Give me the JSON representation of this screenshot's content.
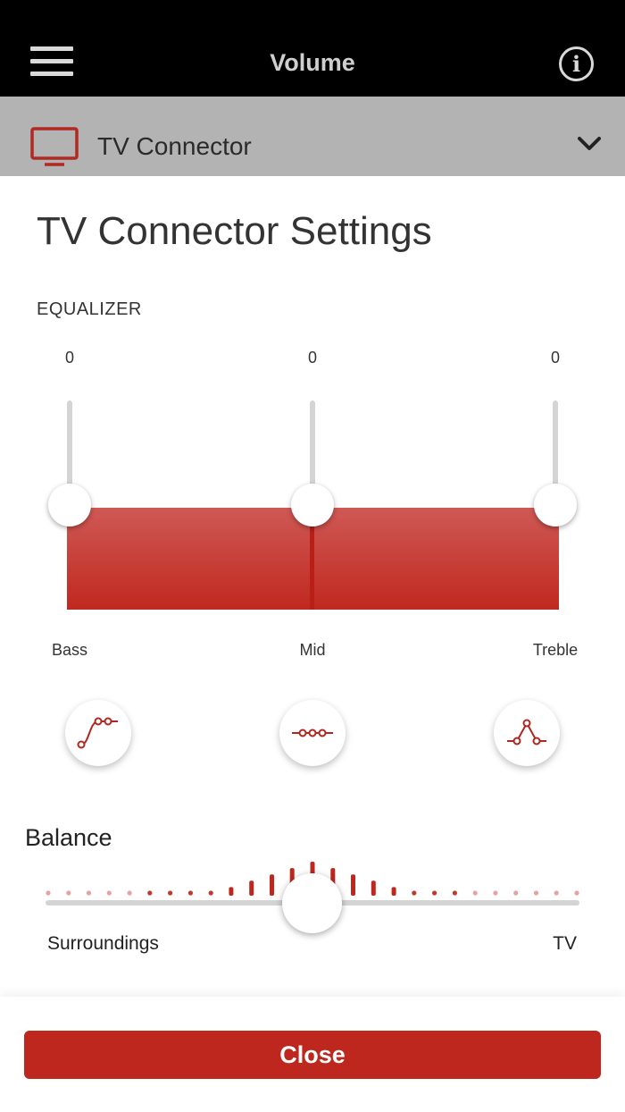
{
  "header": {
    "title": "Volume",
    "menu_icon": "hamburger-menu-icon",
    "info_icon": "info-icon",
    "info_glyph": "i"
  },
  "device": {
    "name": "TV Connector",
    "icon": "tv-icon",
    "expand_icon": "chevron-down-icon"
  },
  "settings": {
    "title": "TV Connector Settings"
  },
  "equalizer": {
    "label": "EQUALIZER",
    "bands": [
      {
        "label": "Bass",
        "value": "0"
      },
      {
        "label": "Mid",
        "value": "0"
      },
      {
        "label": "Treble",
        "value": "0"
      }
    ],
    "presets": [
      {
        "icon": "bass-boost-curve-icon"
      },
      {
        "icon": "flat-curve-icon"
      },
      {
        "icon": "mid-boost-curve-icon"
      }
    ]
  },
  "balance": {
    "label": "Balance",
    "left_label": "Surroundings",
    "right_label": "TV",
    "position": 0.5
  },
  "footer": {
    "close_label": "Close"
  },
  "colors": {
    "accent": "#be271e",
    "header_bg": "#000000",
    "device_bar_bg": "#b3b3b3"
  }
}
